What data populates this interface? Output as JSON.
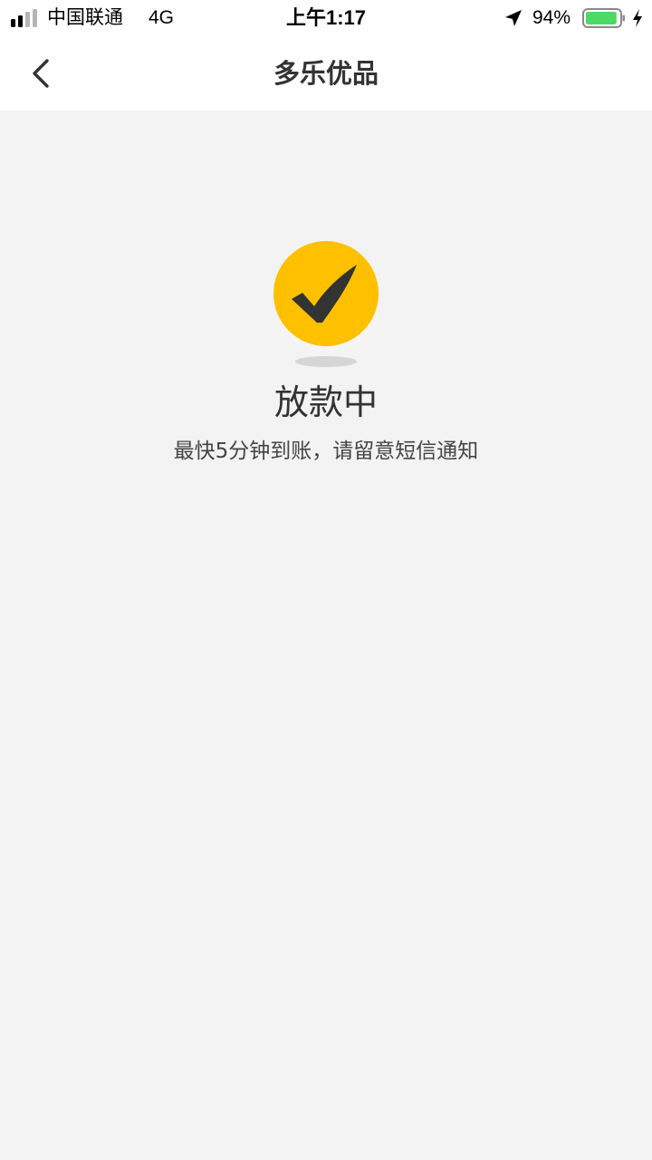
{
  "status_bar": {
    "carrier": "中国联通",
    "network": "4G",
    "time": "上午1:17",
    "battery_percent": "94%",
    "battery_level": 0.94,
    "battery_color": "#4cd964",
    "icons": [
      "signal-icon",
      "location-icon",
      "battery-icon",
      "charging-icon"
    ]
  },
  "nav": {
    "title": "多乐优品",
    "back_icon": "chevron-left-icon"
  },
  "result": {
    "icon": "check-circle-icon",
    "accent_color": "#ffc000",
    "title": "放款中",
    "description": "最快5分钟到账，请留意短信通知"
  }
}
